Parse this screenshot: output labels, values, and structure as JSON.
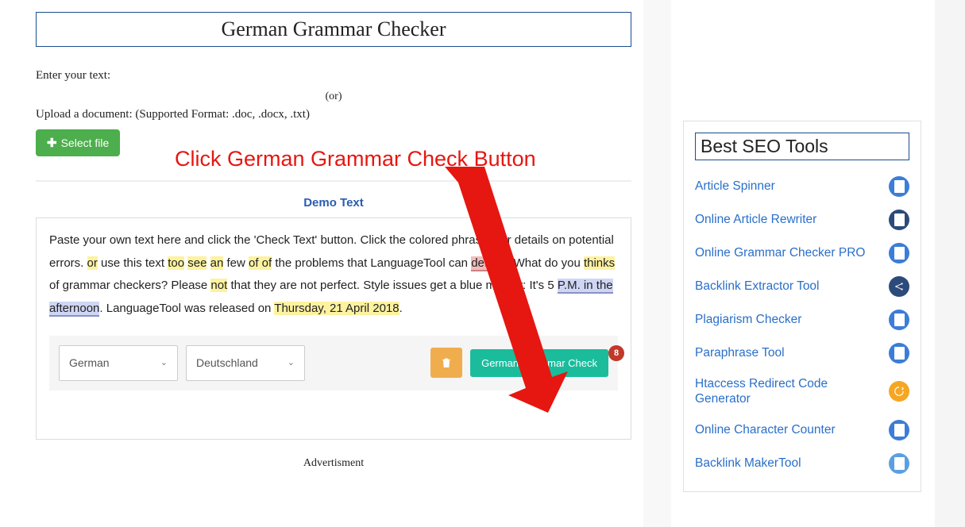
{
  "title": "German Grammar Checker",
  "enter_label": "Enter your text:",
  "or_label": "(or)",
  "upload_label": "Upload a document: (Supported Format: .doc, .docx, .txt)",
  "select_file_label": "Select file",
  "demo_header": "Demo Text",
  "demo_text": {
    "p1a": "Paste your own text here and click the 'Check Text' button. Click the colored phrases for details on potential errors. ",
    "or": "or",
    "p1b": " use this text ",
    "too": "too",
    "sp1": " ",
    "see": "see",
    "sp2": " ",
    "an": "an",
    "p1c": " few ",
    "ofof": "of of",
    "p1d": " the problems that LanguageTool can ",
    "detecd": "detecd",
    "p2a": ". What do you ",
    "thinks": "thinks",
    "p2b": " of grammar checkers? Please ",
    "not": "not",
    "p2c": " that they are not perfect. Style issues get a blue marker: It's 5 ",
    "pm": "P.M. in the afternoon",
    "p3a": ". LanguageTool was released on ",
    "date": "Thursday, 21 April 2018",
    "p3b": "."
  },
  "error_count": "8",
  "lang_select": "German",
  "country_select": "Deutschland",
  "check_button": "German Grammar Check",
  "advertisement": "Advertisment",
  "annotation": "Click German Grammar Check Button",
  "sidebar": {
    "title": "Best SEO Tools",
    "items": [
      {
        "label": "Article Spinner"
      },
      {
        "label": "Online Article Rewriter"
      },
      {
        "label": "Online Grammar Checker PRO"
      },
      {
        "label": "Backlink Extractor Tool"
      },
      {
        "label": "Plagiarism Checker"
      },
      {
        "label": "Paraphrase Tool"
      },
      {
        "label": "Htaccess Redirect Code Generator"
      },
      {
        "label": "Online Character Counter"
      },
      {
        "label": "Backlink MakerTool"
      }
    ]
  }
}
